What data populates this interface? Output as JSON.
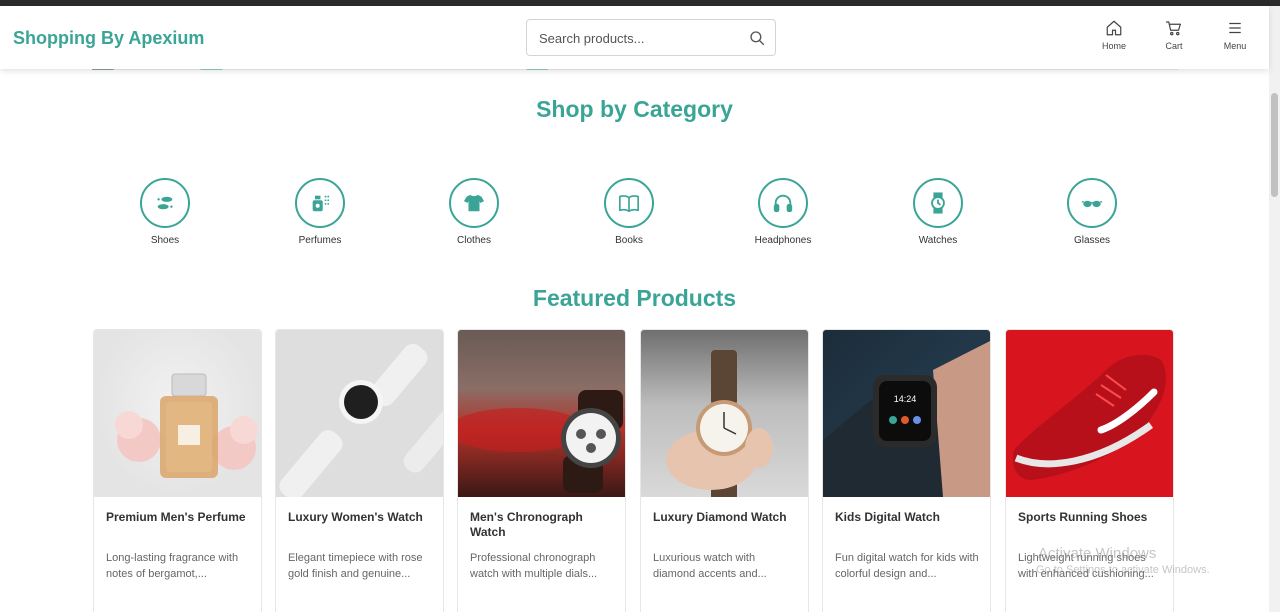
{
  "header": {
    "brand": "Shopping By Apexium",
    "search_placeholder": "Search products...",
    "nav": [
      {
        "label": "Home",
        "icon": "home-icon"
      },
      {
        "label": "Cart",
        "icon": "cart-icon"
      },
      {
        "label": "Menu",
        "icon": "menu-icon"
      }
    ]
  },
  "categories_section": {
    "title": "Shop by Category",
    "items": [
      {
        "label": "Shoes",
        "icon": "shoes-icon"
      },
      {
        "label": "Perfumes",
        "icon": "perfume-icon"
      },
      {
        "label": "Clothes",
        "icon": "tshirt-icon"
      },
      {
        "label": "Books",
        "icon": "book-icon"
      },
      {
        "label": "Headphones",
        "icon": "headphones-icon"
      },
      {
        "label": "Watches",
        "icon": "watch-icon"
      },
      {
        "label": "Glasses",
        "icon": "glasses-icon"
      }
    ]
  },
  "featured_section": {
    "title": "Featured Products",
    "products": [
      {
        "name": "Premium Men's Perfume",
        "description": "Long-lasting fragrance with notes of bergamot,..."
      },
      {
        "name": "Luxury Women's Watch",
        "description": "Elegant timepiece with rose gold finish and genuine..."
      },
      {
        "name": "Men's Chronograph Watch",
        "description": "Professional chronograph watch with multiple dials..."
      },
      {
        "name": "Luxury Diamond Watch",
        "description": "Luxurious watch with diamond accents and..."
      },
      {
        "name": "Kids Digital Watch",
        "description": "Fun digital watch for kids with colorful design and..."
      },
      {
        "name": "Sports Running Shoes",
        "description": "Lightweight running shoes with enhanced cushioning..."
      }
    ]
  },
  "watermark": {
    "line1": "Activate Windows",
    "line2": "Go to Settings to activate Windows."
  },
  "colors": {
    "accent": "#3aa596"
  }
}
